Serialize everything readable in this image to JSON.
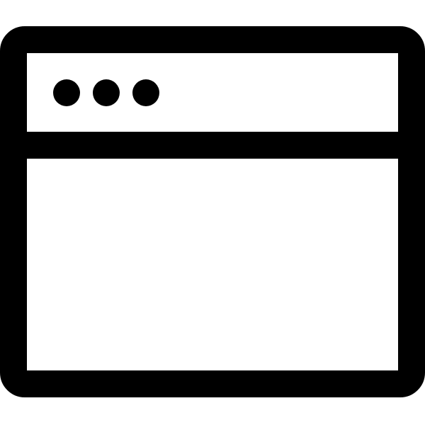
{
  "icon": {
    "name": "browser-window-icon",
    "parts": [
      "window-frame",
      "title-bar",
      "window-dots",
      "content-area"
    ],
    "dot_count": 3
  },
  "colors": {
    "stroke": "#000000",
    "fill": "#ffffff"
  }
}
